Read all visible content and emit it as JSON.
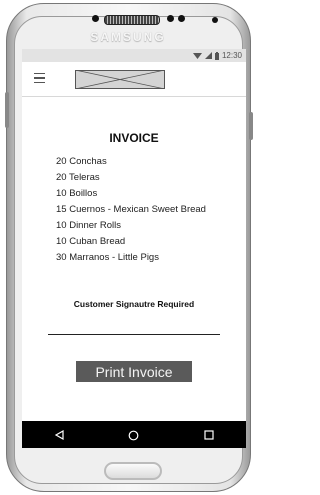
{
  "device": {
    "brand": "SAMSUNG"
  },
  "status_bar": {
    "time": "12:30",
    "icons": [
      "wifi-icon",
      "signal-icon",
      "battery-icon"
    ]
  },
  "app_bar": {
    "menu_icon": "hamburger-menu-icon",
    "logo": "logo-placeholder"
  },
  "invoice": {
    "title": "INVOICE",
    "items": [
      "20 Conchas",
      "20 Teleras",
      "10 Boillos",
      "15 Cuernos - Mexican Sweet Bread",
      "10 Dinner Rolls",
      "10 Cuban Bread",
      "30 Marranos - Little Pigs"
    ],
    "signature_label": "Customer Signautre Required",
    "print_button": "Print Invoice"
  },
  "nav_bar": {
    "icons": [
      "back-icon",
      "home-icon",
      "recents-icon"
    ]
  },
  "colors": {
    "button_bg": "#5a5a5a",
    "navbar_bg": "#000000",
    "status_bar_bg": "#e3e3e3"
  }
}
